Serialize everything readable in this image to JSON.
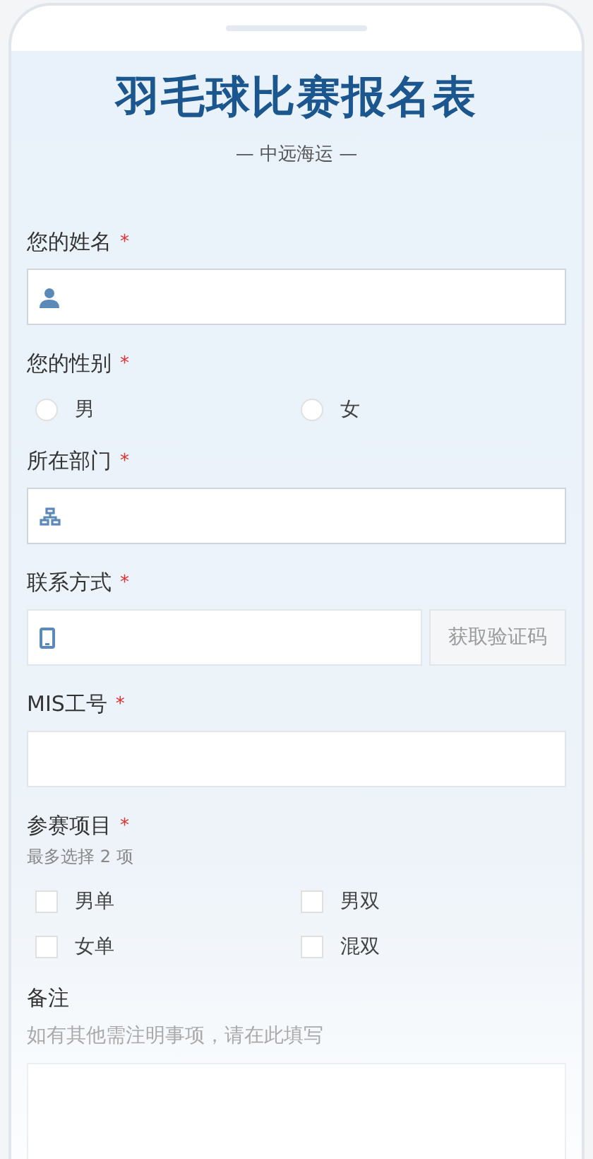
{
  "title": "羽毛球比赛报名表",
  "subtitle": "— 中远海运 —",
  "fields": [
    {
      "kind": "text",
      "label": "您的姓名",
      "required_mark": "*"
    },
    {
      "kind": "radio",
      "label": "您的性别",
      "required_mark": "*",
      "options": [
        {
          "label": "男",
          "selected": false
        },
        {
          "label": "女",
          "selected": false
        }
      ]
    },
    {
      "kind": "text",
      "label": "所在部门",
      "required_mark": "*"
    },
    {
      "kind": "code",
      "label": "联系方式",
      "required_mark": "*",
      "button": "获取验证码"
    },
    {
      "kind": "text",
      "label": "MIS工号",
      "required_mark": "*"
    },
    {
      "kind": "checkbox",
      "label": "参赛项目",
      "required_mark": "*",
      "hint": "最多选择 2 项",
      "options": [
        {
          "label": "男单",
          "checked": false
        },
        {
          "label": "男双",
          "checked": false
        },
        {
          "label": "女单",
          "checked": false
        },
        {
          "label": "混双",
          "checked": false
        }
      ]
    },
    {
      "kind": "textarea",
      "label": "备注",
      "hint": "如有其他需注明事项，请在此填写"
    }
  ]
}
